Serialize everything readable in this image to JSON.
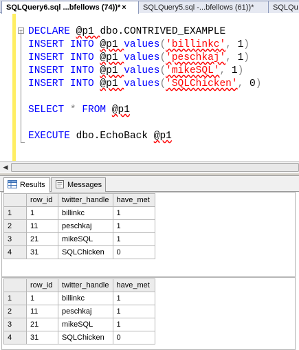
{
  "tabs": [
    {
      "label": "SQLQuery6.sql ...bfellows (74))*",
      "close": "×"
    },
    {
      "label": "SQLQuery5.sql -...bfellows (61))*"
    },
    {
      "label": "SQLQu"
    }
  ],
  "editor": {
    "collapse_glyph": "−",
    "lines": [
      [
        [
          "kw",
          "DECLARE "
        ],
        [
          "tx",
          "@p1 "
        ],
        [
          "tx",
          "dbo.CONTRIVED_EXAMPLE"
        ]
      ],
      [
        [
          "kw",
          "INSERT INTO "
        ],
        [
          "tx",
          "@p1 "
        ],
        [
          "kw",
          "values"
        ],
        [
          "gr",
          "("
        ],
        [
          "st",
          "'billinkc'"
        ],
        [
          "gr",
          ", "
        ],
        [
          "tx",
          "1"
        ],
        [
          "gr",
          ")"
        ]
      ],
      [
        [
          "kw",
          "INSERT INTO "
        ],
        [
          "tx",
          "@p1 "
        ],
        [
          "kw",
          "values"
        ],
        [
          "gr",
          "("
        ],
        [
          "st",
          "'peschkaj'"
        ],
        [
          "gr",
          ", "
        ],
        [
          "tx",
          "1"
        ],
        [
          "gr",
          ")"
        ]
      ],
      [
        [
          "kw",
          "INSERT INTO "
        ],
        [
          "tx",
          "@p1 "
        ],
        [
          "kw",
          "values"
        ],
        [
          "gr",
          "("
        ],
        [
          "st",
          "'mikeSQL'"
        ],
        [
          "gr",
          ", "
        ],
        [
          "tx",
          "1"
        ],
        [
          "gr",
          ")"
        ]
      ],
      [
        [
          "kw",
          "INSERT INTO "
        ],
        [
          "tx",
          "@p1 "
        ],
        [
          "kw",
          "values"
        ],
        [
          "gr",
          "("
        ],
        [
          "st",
          "'SQLChicken'"
        ],
        [
          "gr",
          ", "
        ],
        [
          "tx",
          "0"
        ],
        [
          "gr",
          ")"
        ]
      ],
      [],
      [
        [
          "kw",
          "SELECT "
        ],
        [
          "gr",
          "* "
        ],
        [
          "kw",
          "FROM "
        ],
        [
          "tx",
          "@p1"
        ]
      ],
      [],
      [
        [
          "kw",
          "EXECUTE "
        ],
        [
          "tx",
          "dbo.EchoBack "
        ],
        [
          "tx",
          "@p1"
        ]
      ]
    ]
  },
  "scrollbar": {
    "left_arrow": "◀"
  },
  "result_tabs": [
    {
      "label": "Results",
      "icon": "grid-icon"
    },
    {
      "label": "Messages",
      "icon": "messages-icon"
    }
  ],
  "grids": [
    {
      "columns": [
        "row_id",
        "twitter_handle",
        "have_met"
      ],
      "rows": [
        {
          "n": "1",
          "cells": [
            "1",
            "billinkc",
            "1"
          ]
        },
        {
          "n": "2",
          "cells": [
            "11",
            "peschkaj",
            "1"
          ]
        },
        {
          "n": "3",
          "cells": [
            "21",
            "mikeSQL",
            "1"
          ]
        },
        {
          "n": "4",
          "cells": [
            "31",
            "SQLChicken",
            "0"
          ]
        }
      ]
    },
    {
      "columns": [
        "row_id",
        "twitter_handle",
        "have_met"
      ],
      "rows": [
        {
          "n": "1",
          "cells": [
            "1",
            "billinkc",
            "1"
          ]
        },
        {
          "n": "2",
          "cells": [
            "11",
            "peschkaj",
            "1"
          ]
        },
        {
          "n": "3",
          "cells": [
            "21",
            "mikeSQL",
            "1"
          ]
        },
        {
          "n": "4",
          "cells": [
            "31",
            "SQLChicken",
            "0"
          ]
        }
      ]
    }
  ]
}
